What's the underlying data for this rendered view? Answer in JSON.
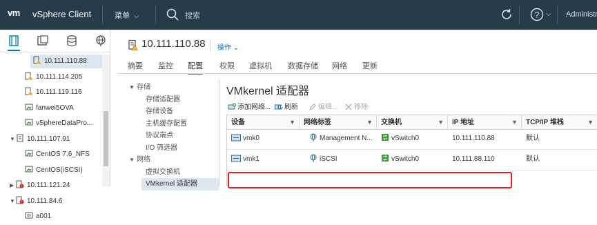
{
  "topbar": {
    "logo": "vm",
    "app_title": "vSphere Client",
    "menu_label": "菜单",
    "search_placeholder": "搜索",
    "user": "Administra"
  },
  "nav": {
    "tree": [
      {
        "label": "10.111.110.88",
        "icon": "host-warning-icon",
        "indent": 1,
        "selected": true
      },
      {
        "label": "10.111.114.205",
        "icon": "host-warning-icon",
        "indent": 1
      },
      {
        "label": "10.111.119.116",
        "icon": "host-warning-icon",
        "indent": 1
      },
      {
        "label": "fanwei5OVA",
        "icon": "vm-icon",
        "indent": 1
      },
      {
        "label": "vSphereDataPro...",
        "icon": "vm-icon",
        "indent": 1
      },
      {
        "label": "10.111.107.91",
        "icon": "host-icon",
        "indent": 0,
        "expanded": true
      },
      {
        "label": "CentOS 7.6_NFS",
        "icon": "vm-icon",
        "indent": 1
      },
      {
        "label": "CentOS(iSCSI)",
        "icon": "vm-icon",
        "indent": 1
      },
      {
        "label": "10.111.121.24",
        "icon": "host-alert-icon",
        "indent": 0,
        "expanded": false
      },
      {
        "label": "10.111.84.6",
        "icon": "host-alert-icon",
        "indent": 0,
        "expanded": true
      },
      {
        "label": "a001",
        "icon": "vm-off-icon",
        "indent": 1
      }
    ]
  },
  "header": {
    "title": "10.111.110.88",
    "actions_label": "操作"
  },
  "tabs": [
    "摘要",
    "监控",
    "配置",
    "权限",
    "虚拟机",
    "数据存储",
    "网络",
    "更新"
  ],
  "active_tab": "配置",
  "side_menu": [
    {
      "label": "存储",
      "type": "section"
    },
    {
      "label": "存储适配器",
      "type": "item"
    },
    {
      "label": "存储设备",
      "type": "item"
    },
    {
      "label": "主机缓存配置",
      "type": "item"
    },
    {
      "label": "协议端点",
      "type": "item"
    },
    {
      "label": "I/O 筛选器",
      "type": "item"
    },
    {
      "label": "网络",
      "type": "section"
    },
    {
      "label": "虚拟交换机",
      "type": "item"
    },
    {
      "label": "VMkernel 适配器",
      "type": "item",
      "selected": true
    }
  ],
  "content": {
    "title": "VMkernel 适配器",
    "toolbar": {
      "add": "添加网络...",
      "refresh": "刷新",
      "edit": "编辑...",
      "remove": "移除"
    },
    "columns": [
      "设备",
      "网络标签",
      "交换机",
      "IP 地址",
      "TCP/IP 堆栈"
    ],
    "rows": [
      {
        "device": "vmk0",
        "network": "Management N...",
        "switch": "vSwitch0",
        "ip": "10.111.110.88",
        "stack": "默认"
      },
      {
        "device": "vmk1",
        "network": "iSCSI",
        "switch": "vSwitch0",
        "ip": "10.111.88.110",
        "stack": "默认"
      }
    ]
  },
  "colors": {
    "accent": "#0079b8",
    "topbar": "#273c4b",
    "highlight": "#e02020"
  }
}
